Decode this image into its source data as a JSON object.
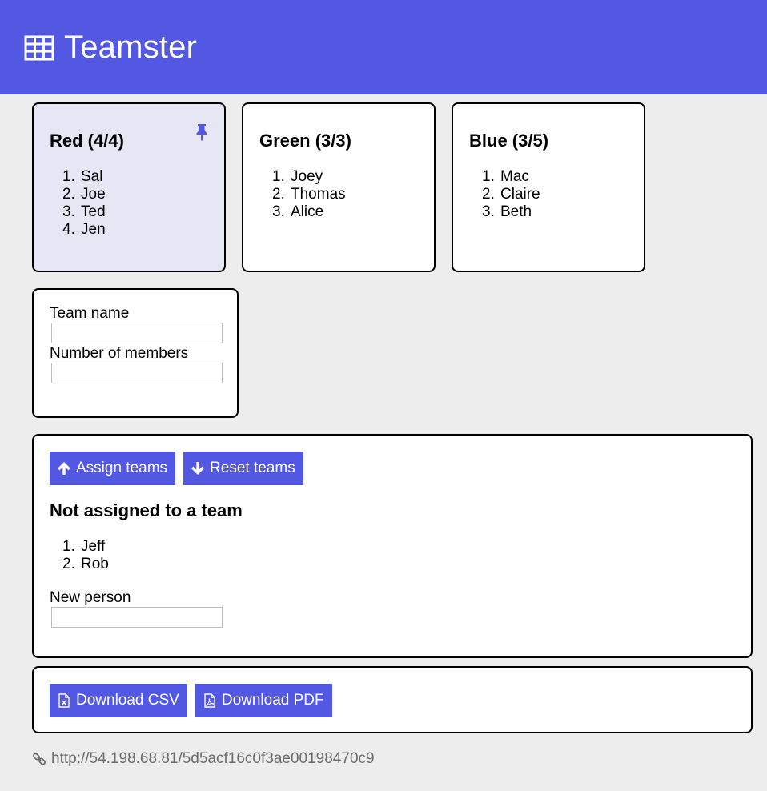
{
  "app": {
    "title": "Teamster",
    "logo_icon": "table-icon",
    "brand_color": "#5358e2"
  },
  "teams": [
    {
      "label": "Red (4/4)",
      "pinned": true,
      "members": [
        {
          "num": "1.",
          "name": "Sal"
        },
        {
          "num": "2.",
          "name": "Joe"
        },
        {
          "num": "3.",
          "name": "Ted"
        },
        {
          "num": "4.",
          "name": "Jen"
        }
      ]
    },
    {
      "label": "Green (3/3)",
      "pinned": false,
      "members": [
        {
          "num": "1.",
          "name": "Joey"
        },
        {
          "num": "2.",
          "name": "Thomas"
        },
        {
          "num": "3.",
          "name": "Alice"
        }
      ]
    },
    {
      "label": "Blue (3/5)",
      "pinned": false,
      "members": [
        {
          "num": "1.",
          "name": "Mac"
        },
        {
          "num": "2.",
          "name": "Claire"
        },
        {
          "num": "3.",
          "name": "Beth"
        }
      ]
    }
  ],
  "new_team_form": {
    "team_name_label": "Team name",
    "team_name_value": "",
    "members_label": "Number of members",
    "members_value": ""
  },
  "assignment": {
    "assign_button": "Assign teams",
    "reset_button": "Reset teams",
    "unassigned_heading": "Not assigned to a team",
    "unassigned": [
      {
        "num": "1.",
        "name": "Jeff"
      },
      {
        "num": "2.",
        "name": "Rob"
      }
    ],
    "new_person_label": "New person",
    "new_person_value": ""
  },
  "downloads": {
    "csv_button": "Download CSV",
    "pdf_button": "Download PDF"
  },
  "footer": {
    "share_url": "http://54.198.68.81/5d5acf16c0f3ae00198470c9",
    "icon": "link-icon"
  }
}
